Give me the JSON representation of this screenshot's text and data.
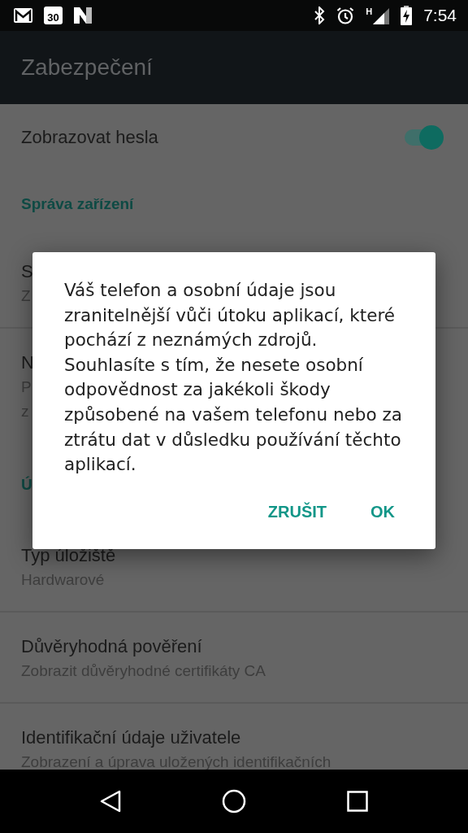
{
  "status_bar": {
    "calendar_day": "30",
    "network_type": "H",
    "time": "7:54"
  },
  "app_bar": {
    "title": "Zabezpečení"
  },
  "settings": [
    {
      "kind": "toggle",
      "title": "Zobrazovat hesla",
      "on": true
    },
    {
      "kind": "category",
      "title": "Správa zařízení"
    },
    {
      "kind": "item",
      "title": "S",
      "summary": [
        "Z"
      ]
    },
    {
      "kind": "item",
      "title": "N",
      "summary": [
        "P",
        "z"
      ]
    },
    {
      "kind": "category",
      "title": "Ú"
    },
    {
      "kind": "item",
      "title": "Typ úložiště",
      "summary": [
        "Hardwarové"
      ]
    },
    {
      "kind": "item",
      "title": "Důvěryhodná pověření",
      "summary": [
        "Zobrazit důvěryhodné certifikáty CA"
      ]
    },
    {
      "kind": "item",
      "title": "Identifikační údaje uživatele",
      "summary": [
        "Zobrazení a úprava uložených identifikačních"
      ]
    }
  ],
  "dialog": {
    "message": "Váš telefon a osobní údaje jsou zranitelnější vůči útoku aplikací, které pochází z neznámých zdrojů. Souhlasíte s tím, že nesete osobní odpovědnost za jakékoli škody způsobené na vašem telefonu nebo za ztrátu dat v důsledku používání těchto aplikací.",
    "buttons": [
      "ZRUŠIT",
      "OK"
    ]
  }
}
